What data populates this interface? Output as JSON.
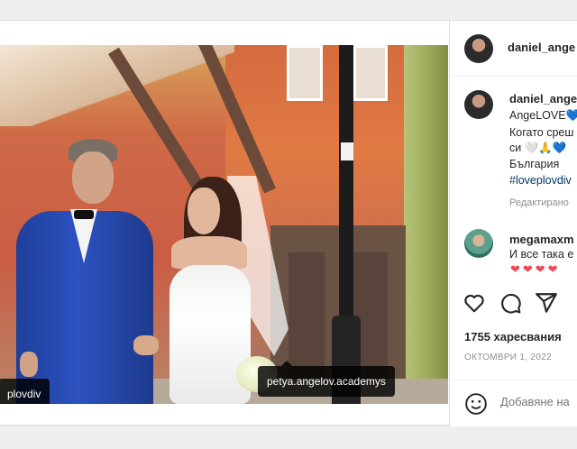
{
  "post": {
    "author": "daniel_ange",
    "photo_tags": [
      "plovdiv",
      "petya.angelov.academys"
    ],
    "caption": {
      "username": "daniel_ange",
      "lines": [
        "AngeLOVE💙",
        "Когато среш",
        "си 🤍🙏💙",
        "България"
      ],
      "hashtag": "#loveplovdiv",
      "edited": "Редактирано"
    },
    "comment": {
      "username": "megamaxm",
      "text": "И все така е",
      "hearts": "❤❤❤❤"
    },
    "likes": "1755 харесвания",
    "date": "ОКТОМВРИ 1, 2022",
    "add_comment_placeholder": "Добавяне на"
  },
  "icons": {
    "like": "heart-icon",
    "comment": "comment-icon",
    "share": "share-icon",
    "emoji": "emoji-icon"
  },
  "colors": {
    "hashtag": "#00376b",
    "heart": "#ed4956",
    "muted": "#8e8e8e"
  }
}
